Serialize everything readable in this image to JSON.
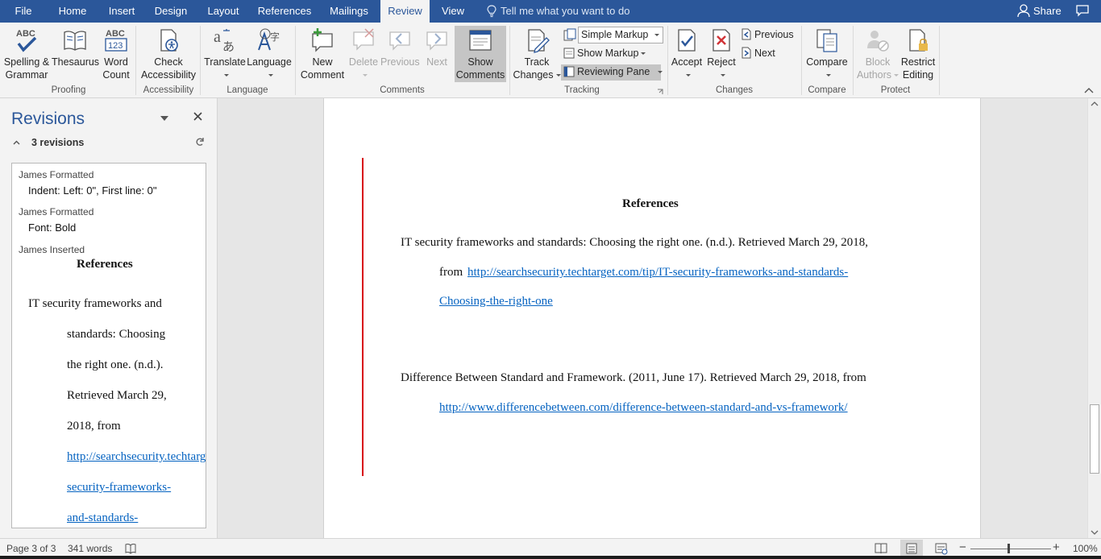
{
  "tabs": [
    {
      "label": "File",
      "active": false
    },
    {
      "label": "Home",
      "active": false
    },
    {
      "label": "Insert",
      "active": false
    },
    {
      "label": "Design",
      "active": false
    },
    {
      "label": "Layout",
      "active": false
    },
    {
      "label": "References",
      "active": false
    },
    {
      "label": "Mailings",
      "active": false
    },
    {
      "label": "Review",
      "active": true
    },
    {
      "label": "View",
      "active": false
    }
  ],
  "tell_me": "Tell me what you want to do",
  "share": "Share",
  "ribbon": {
    "proofing": {
      "group": "Proofing",
      "spelling": "Spelling &",
      "spelling2": "Grammar",
      "thesaurus": "Thesaurus",
      "word": "Word",
      "count": "Count",
      "abc_icon_text": "ABC",
      "abc_num": "123"
    },
    "accessibility": {
      "group": "Accessibility",
      "line1": "Check",
      "line2": "Accessibility"
    },
    "language": {
      "group": "Language",
      "translate": "Translate",
      "language": "Language"
    },
    "comments": {
      "group": "Comments",
      "new1": "New",
      "new2": "Comment",
      "delete": "Delete",
      "previous": "Previous",
      "next": "Next",
      "show1": "Show",
      "show2": "Comments"
    },
    "tracking": {
      "group": "Tracking",
      "track1": "Track",
      "track2": "Changes",
      "markup_select": "Simple Markup",
      "show_markup": "Show Markup",
      "reviewing_pane": "Reviewing Pane"
    },
    "changes": {
      "group": "Changes",
      "accept": "Accept",
      "reject": "Reject",
      "previous": "Previous",
      "next": "Next"
    },
    "compare": {
      "group": "Compare",
      "compare": "Compare"
    },
    "protect": {
      "group": "Protect",
      "block1": "Block",
      "block2": "Authors",
      "restrict1": "Restrict",
      "restrict2": "Editing"
    }
  },
  "revisions_pane": {
    "title": "Revisions",
    "count": "3 revisions",
    "items": [
      {
        "author": "James Formatted",
        "detail": "Indent: Left:  0\", First line:  0\""
      },
      {
        "author": "James Formatted",
        "detail": "Font: Bold"
      },
      {
        "author": "James Inserted",
        "detail": ""
      }
    ],
    "inserted_heading": "References",
    "inserted_lines": [
      "IT security frameworks and",
      "standards: Choosing",
      "the right one. (n.d.).",
      "Retrieved March 29,",
      "2018, from"
    ],
    "inserted_links": [
      "http://searchsecurity.techtarget.com/tip/IT-",
      "security-frameworks-",
      "and-standards-"
    ]
  },
  "document": {
    "heading": "References",
    "ref1_line1": "IT security frameworks and standards: Choosing the right one. (n.d.). Retrieved March 29, 2018,",
    "ref1_from": "from",
    "ref1_link1": "http://searchsecurity.techtarget.com/tip/IT-security-frameworks-and-standards-",
    "ref1_link2": "Choosing-the-right-one",
    "ref2_line1": "Difference Between Standard and Framework. (2011, June 17). Retrieved March 29, 2018, from",
    "ref2_link": "http://www.differencebetween.com/difference-between-standard-and-vs-framework/"
  },
  "status": {
    "page": "Page 3 of 3",
    "words": "341 words",
    "zoom": "100%",
    "zoom_minus": "−",
    "zoom_plus": "+"
  },
  "colors": {
    "brand": "#2b579a",
    "link": "#0563c1",
    "change_bar": "#d8000c"
  }
}
